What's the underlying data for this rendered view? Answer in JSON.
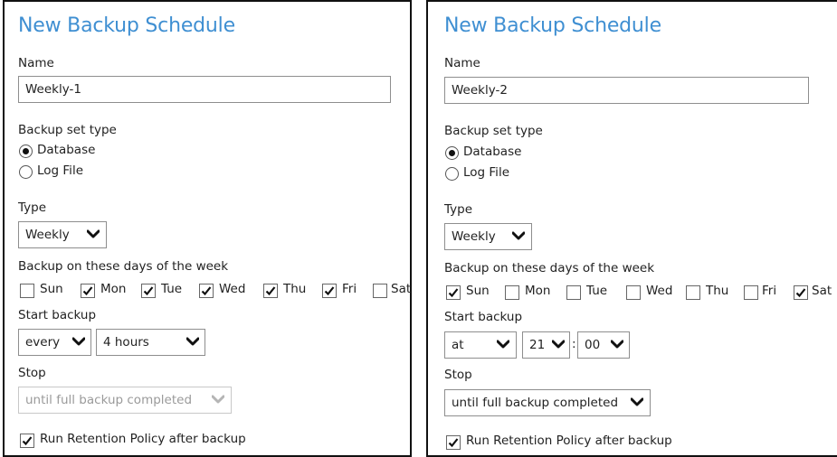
{
  "left": {
    "title": "New Backup Schedule",
    "name_label": "Name",
    "name_value": "Weekly-1",
    "backup_set_type_label": "Backup set type",
    "backup_set_type_options": [
      {
        "label": "Database",
        "selected": true
      },
      {
        "label": "Log File",
        "selected": false
      }
    ],
    "type_label": "Type",
    "type_value": "Weekly",
    "days_label": "Backup on these days of the week",
    "days": [
      {
        "label": "Sun",
        "checked": false
      },
      {
        "label": "Mon",
        "checked": true
      },
      {
        "label": "Tue",
        "checked": true
      },
      {
        "label": "Wed",
        "checked": true
      },
      {
        "label": "Thu",
        "checked": true
      },
      {
        "label": "Fri",
        "checked": true
      },
      {
        "label": "Sat",
        "checked": false
      }
    ],
    "start_backup_label": "Start backup",
    "start_mode": "every",
    "start_interval": "4 hours",
    "stop_label": "Stop",
    "stop_value": "until full backup completed",
    "stop_disabled": true,
    "retention_label": "Run Retention Policy after backup",
    "retention_checked": true
  },
  "right": {
    "title": "New Backup Schedule",
    "name_label": "Name",
    "name_value": "Weekly-2",
    "backup_set_type_label": "Backup set type",
    "backup_set_type_options": [
      {
        "label": "Database",
        "selected": true
      },
      {
        "label": "Log File",
        "selected": false
      }
    ],
    "type_label": "Type",
    "type_value": "Weekly",
    "days_label": "Backup on these days of the week",
    "days": [
      {
        "label": "Sun",
        "checked": true
      },
      {
        "label": "Mon",
        "checked": false
      },
      {
        "label": "Tue",
        "checked": false
      },
      {
        "label": "Wed",
        "checked": false
      },
      {
        "label": "Thu",
        "checked": false
      },
      {
        "label": "Fri",
        "checked": false
      },
      {
        "label": "Sat",
        "checked": true
      }
    ],
    "start_backup_label": "Start backup",
    "start_mode": "at",
    "start_hour": "21",
    "time_separator": ":",
    "start_minute": "00",
    "stop_label": "Stop",
    "stop_value": "until full backup completed",
    "stop_disabled": false,
    "retention_label": "Run Retention Policy after backup",
    "retention_checked": true
  },
  "colors": {
    "title": "#3f8fd2",
    "border": "#8e8e8e",
    "disabled_text": "#9a9a9a"
  }
}
